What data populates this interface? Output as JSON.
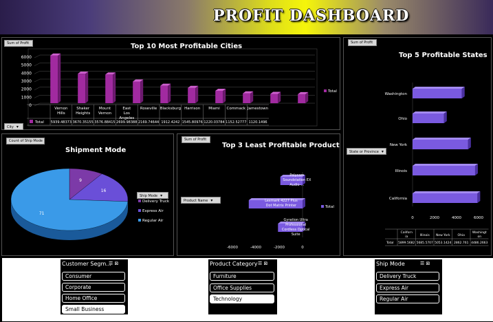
{
  "dashboard": {
    "title": "PROFIT DASHBOARD"
  },
  "panels": {
    "cities": {
      "pivot_button": "Sum of Profit",
      "title": "Top 10 Most Profitable Cities",
      "field_button": "City",
      "legend": "Total"
    },
    "shipment": {
      "pivot_button": "Count of Ship Mode",
      "title": "Shipment Mode",
      "field_button": "Ship Mode"
    },
    "least": {
      "pivot_button": "Sum of Profit",
      "title": "Top 3 Least Profitable Product",
      "field_button": "Product Name",
      "legend": "Total"
    },
    "states": {
      "pivot_button": "Sum of Profit",
      "title": "Top 5 Profitable States",
      "field_button": "State or Province"
    }
  },
  "chart_data": [
    {
      "type": "bar",
      "title": "Top 10 Most Profitable Cities",
      "categories": [
        "Vernon Hills",
        "Shaker Heights",
        "Mount Vernon",
        "East Los Angeles",
        "Roseville",
        "Blacksburg",
        "Harrison",
        "Miami",
        "Commack",
        "Jamestown"
      ],
      "series": [
        {
          "name": "Total",
          "values": [
            5939.48373,
            3670.35155,
            3576.88415,
            2699.98388,
            2169.74644,
            1912.4242,
            1545.80976,
            1220.03784,
            1152.52777,
            1120.1496
          ]
        }
      ],
      "table_values": [
        "5939.48373",
        "3670.35155",
        "3576.88415",
        "2699.98388",
        "2169.74644",
        "1912.4242",
        "1545.80976",
        "1220.03784",
        "1152.52777",
        "1120.1496"
      ],
      "table_row_label": "Total",
      "yticks": [
        "6000",
        "5000",
        "4000",
        "3000",
        "2000",
        "1000",
        "0"
      ],
      "ylim": [
        0,
        6000
      ]
    },
    {
      "type": "pie",
      "title": "Shipment Mode",
      "categories": [
        "Delivery Truck",
        "Express Air",
        "Regular Air"
      ],
      "values": [
        9,
        16,
        71
      ],
      "colors": [
        "#7c3aa8",
        "#6a4fd8",
        "#3a9ae8"
      ]
    },
    {
      "type": "bar",
      "title": "Top 3 Least Profitable Product",
      "categories": [
        "Polycom Soundstation EX Audio-...",
        "Lexmark 4227 Plus Dot Matrix Printer",
        "Gyration Ultra Professional Cordless Optical Suite"
      ],
      "series": [
        {
          "name": "Total",
          "values": [
            -1900,
            -4600,
            -2100
          ]
        }
      ],
      "xticks": [
        "-6000",
        "-4000",
        "-2000",
        "0"
      ],
      "xlim": [
        -6000,
        0
      ]
    },
    {
      "type": "bar",
      "title": "Top 5 Profitable States",
      "categories": [
        "Washington",
        "Ohio",
        "New York",
        "Illinois",
        "California"
      ],
      "series": [
        {
          "name": "Total",
          "values": [
            4486.2663,
            2862.761,
            5053.1424,
            5685.5707,
            5899.5682
          ]
        }
      ],
      "table_headers": [
        "California",
        "Illinois",
        "New York",
        "Ohio",
        "Washington"
      ],
      "table_values": [
        "5899.5682",
        "5685.5707",
        "5053.1424",
        "2862.761",
        "4486.2663"
      ],
      "table_row_label": "Total",
      "xticks": [
        "0",
        "2000",
        "4000",
        "6000"
      ],
      "xlim": [
        0,
        6000
      ]
    }
  ],
  "slicers": [
    {
      "header": "Customer Segm...",
      "items": [
        "Consumer",
        "Corporate",
        "Home Office",
        "Small Business"
      ],
      "selected": [
        3
      ]
    },
    {
      "header": "Product Category",
      "items": [
        "Furniture",
        "Office Supplies",
        "Technology"
      ],
      "selected": [
        2
      ]
    },
    {
      "header": "Ship Mode",
      "items": [
        "Delivery Truck",
        "Express Air",
        "Regular Air"
      ],
      "selected": []
    }
  ],
  "icons": {
    "multiselect": "multiselect-icon",
    "clear_filter": "clear-filter-icon",
    "dropdown": "dropdown-arrow-icon"
  }
}
